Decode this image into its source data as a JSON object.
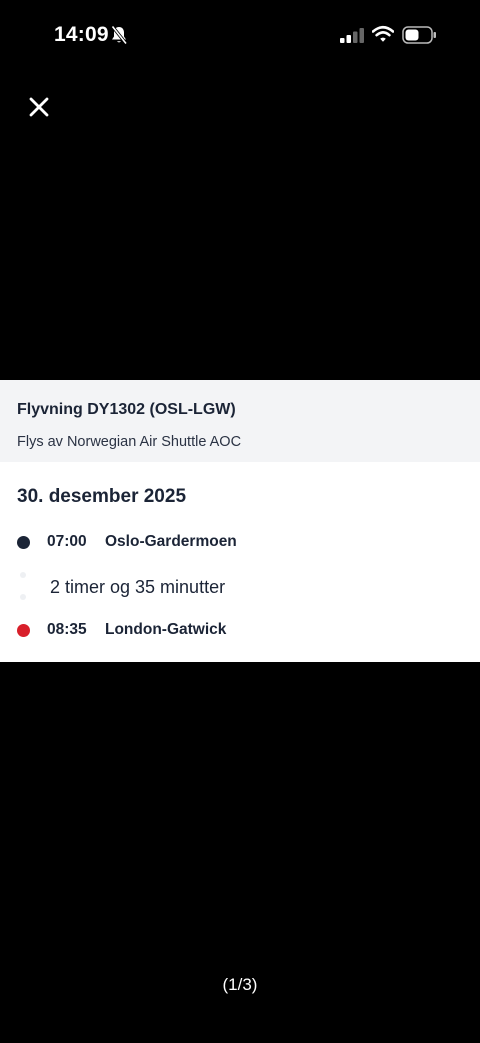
{
  "status_bar": {
    "time": "14:09",
    "icons": [
      "bell-slash-icon",
      "signal-icon",
      "wifi-icon",
      "battery-icon"
    ]
  },
  "close_icon": "close-icon",
  "flight": {
    "title": "Flyvning DY1302 (OSL-LGW)",
    "operator": "Flys av Norwegian Air Shuttle AOC",
    "date": "30. desember 2025",
    "departure": {
      "time": "07:00",
      "place": "Oslo-Gardermoen",
      "dot_color": "#1b2436"
    },
    "duration": "2 timer og 35 minutter",
    "arrival": {
      "time": "08:35",
      "place": "London-Gatwick",
      "dot_color": "#d81f2a"
    }
  },
  "pager": "(1/3)"
}
